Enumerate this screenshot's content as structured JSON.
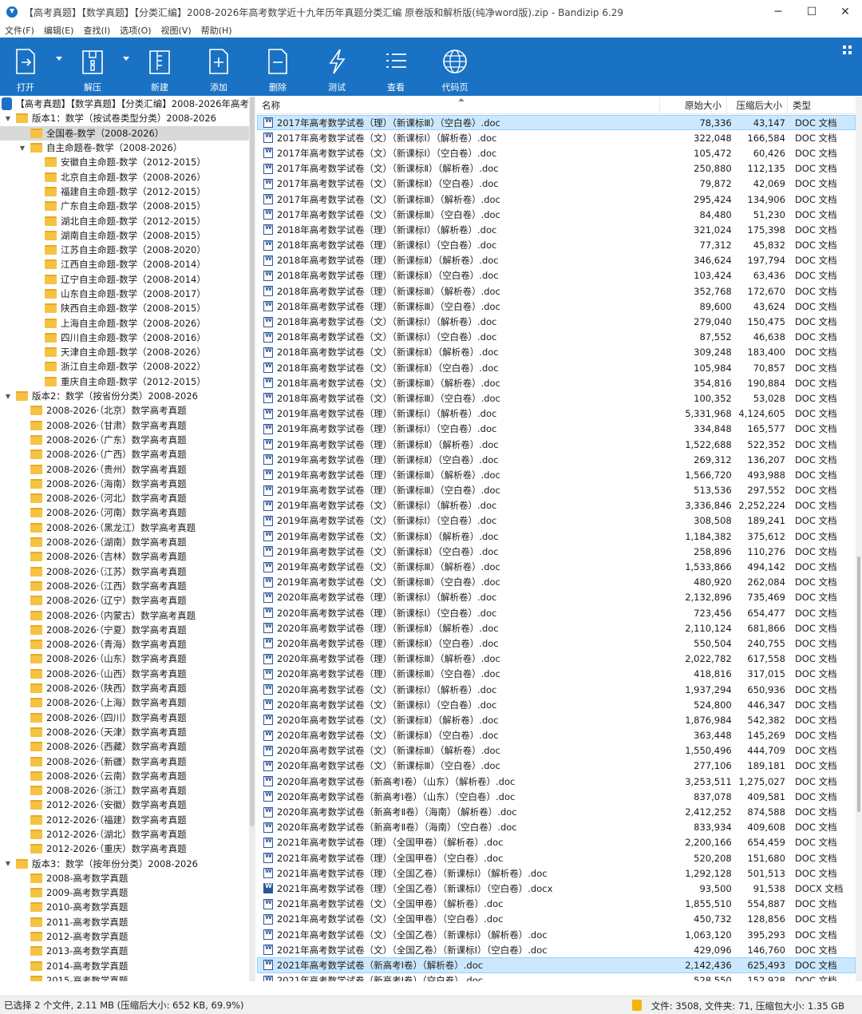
{
  "window": {
    "title": "【高考真题】【数学真题】【分类汇编】2008-2026年高考数学近十九年历年真题分类汇编  原卷版和解析版(纯净word版).zip - Bandizip 6.29",
    "minimize": "─",
    "maximize": "☐",
    "close": "✕"
  },
  "menu": [
    "文件(F)",
    "编辑(E)",
    "查找(I)",
    "选项(O)",
    "视图(V)",
    "帮助(H)"
  ],
  "toolbar": {
    "open": "打开",
    "extract": "解压",
    "new": "新建",
    "add": "添加",
    "delete": "删除",
    "test": "测试",
    "view": "查看",
    "codepage": "代码页"
  },
  "colors": {
    "toolbar": "#1a72c4",
    "selected_row": "#cce8ff",
    "folder": "#f5c242"
  },
  "tree": [
    {
      "text": "【高考真题】【数学真题】【分类汇编】2008-2026年高考",
      "level": 0,
      "type": "zip",
      "toggle": ""
    },
    {
      "text": "版本1：数学（按试卷类型分类）2008-2026",
      "level": 0,
      "type": "folder",
      "toggle": "▼"
    },
    {
      "text": "全国卷-数学（2008-2026）",
      "level": 1,
      "type": "folder",
      "toggle": "",
      "selected": true
    },
    {
      "text": "自主命题卷-数学（2008-2026）",
      "level": 1,
      "type": "folder",
      "toggle": "▼"
    },
    {
      "text": "安徽自主命题-数学（2012-2015）",
      "level": 2,
      "type": "folder",
      "toggle": ""
    },
    {
      "text": "北京自主命题-数学（2008-2026）",
      "level": 2,
      "type": "folder",
      "toggle": ""
    },
    {
      "text": "福建自主命题-数学（2012-2015）",
      "level": 2,
      "type": "folder",
      "toggle": ""
    },
    {
      "text": "广东自主命题-数学（2008-2015）",
      "level": 2,
      "type": "folder",
      "toggle": ""
    },
    {
      "text": "湖北自主命题-数学（2012-2015）",
      "level": 2,
      "type": "folder",
      "toggle": ""
    },
    {
      "text": "湖南自主命题-数学（2008-2015）",
      "level": 2,
      "type": "folder",
      "toggle": ""
    },
    {
      "text": "江苏自主命题-数学（2008-2020）",
      "level": 2,
      "type": "folder",
      "toggle": ""
    },
    {
      "text": "江西自主命题-数学（2008-2014）",
      "level": 2,
      "type": "folder",
      "toggle": ""
    },
    {
      "text": "辽宁自主命题-数学（2008-2014）",
      "level": 2,
      "type": "folder",
      "toggle": ""
    },
    {
      "text": "山东自主命题-数学（2008-2017）",
      "level": 2,
      "type": "folder",
      "toggle": ""
    },
    {
      "text": "陕西自主命题-数学（2008-2015）",
      "level": 2,
      "type": "folder",
      "toggle": ""
    },
    {
      "text": "上海自主命题-数学（2008-2026）",
      "level": 2,
      "type": "folder",
      "toggle": ""
    },
    {
      "text": "四川自主命题-数学（2008-2016）",
      "level": 2,
      "type": "folder",
      "toggle": ""
    },
    {
      "text": "天津自主命题-数学（2008-2026）",
      "level": 2,
      "type": "folder",
      "toggle": ""
    },
    {
      "text": "浙江自主命题-数学（2008-2022）",
      "level": 2,
      "type": "folder",
      "toggle": ""
    },
    {
      "text": "重庆自主命题-数学（2012-2015）",
      "level": 2,
      "type": "folder",
      "toggle": ""
    },
    {
      "text": "版本2：数学（按省份分类）2008-2026",
      "level": 0,
      "type": "folder",
      "toggle": "▼"
    },
    {
      "text": "2008-2026·（北京）数学高考真题",
      "level": 1,
      "type": "folder",
      "toggle": ""
    },
    {
      "text": "2008-2026·（甘肃）数学高考真题",
      "level": 1,
      "type": "folder",
      "toggle": ""
    },
    {
      "text": "2008-2026·（广东）数学高考真题",
      "level": 1,
      "type": "folder",
      "toggle": ""
    },
    {
      "text": "2008-2026·（广西）数学高考真题",
      "level": 1,
      "type": "folder",
      "toggle": ""
    },
    {
      "text": "2008-2026·（贵州）数学高考真题",
      "level": 1,
      "type": "folder",
      "toggle": ""
    },
    {
      "text": "2008-2026·（海南）数学高考真题",
      "level": 1,
      "type": "folder",
      "toggle": ""
    },
    {
      "text": "2008-2026·（河北）数学高考真题",
      "level": 1,
      "type": "folder",
      "toggle": ""
    },
    {
      "text": "2008-2026·（河南）数学高考真题",
      "level": 1,
      "type": "folder",
      "toggle": ""
    },
    {
      "text": "2008-2026·（黑龙江）数学高考真题",
      "level": 1,
      "type": "folder",
      "toggle": ""
    },
    {
      "text": "2008-2026·（湖南）数学高考真题",
      "level": 1,
      "type": "folder",
      "toggle": ""
    },
    {
      "text": "2008-2026·（吉林）数学高考真题",
      "level": 1,
      "type": "folder",
      "toggle": ""
    },
    {
      "text": "2008-2026·（江苏）数学高考真题",
      "level": 1,
      "type": "folder",
      "toggle": ""
    },
    {
      "text": "2008-2026·（江西）数学高考真题",
      "level": 1,
      "type": "folder",
      "toggle": ""
    },
    {
      "text": "2008-2026·（辽宁）数学高考真题",
      "level": 1,
      "type": "folder",
      "toggle": ""
    },
    {
      "text": "2008-2026·（内蒙古）数学高考真题",
      "level": 1,
      "type": "folder",
      "toggle": ""
    },
    {
      "text": "2008-2026·（宁夏）数学高考真题",
      "level": 1,
      "type": "folder",
      "toggle": ""
    },
    {
      "text": "2008-2026·（青海）数学高考真题",
      "level": 1,
      "type": "folder",
      "toggle": ""
    },
    {
      "text": "2008-2026·（山东）数学高考真题",
      "level": 1,
      "type": "folder",
      "toggle": ""
    },
    {
      "text": "2008-2026·（山西）数学高考真题",
      "level": 1,
      "type": "folder",
      "toggle": ""
    },
    {
      "text": "2008-2026·（陕西）数学高考真题",
      "level": 1,
      "type": "folder",
      "toggle": ""
    },
    {
      "text": "2008-2026·（上海）数学高考真题",
      "level": 1,
      "type": "folder",
      "toggle": ""
    },
    {
      "text": "2008-2026·（四川）数学高考真题",
      "level": 1,
      "type": "folder",
      "toggle": ""
    },
    {
      "text": "2008-2026·（天津）数学高考真题",
      "level": 1,
      "type": "folder",
      "toggle": ""
    },
    {
      "text": "2008-2026·（西藏）数学高考真题",
      "level": 1,
      "type": "folder",
      "toggle": ""
    },
    {
      "text": "2008-2026·（新疆）数学高考真题",
      "level": 1,
      "type": "folder",
      "toggle": ""
    },
    {
      "text": "2008-2026·（云南）数学高考真题",
      "level": 1,
      "type": "folder",
      "toggle": ""
    },
    {
      "text": "2008-2026·（浙江）数学高考真题",
      "level": 1,
      "type": "folder",
      "toggle": ""
    },
    {
      "text": "2012-2026·（安徽）数学高考真题",
      "level": 1,
      "type": "folder",
      "toggle": ""
    },
    {
      "text": "2012-2026·（福建）数学高考真题",
      "level": 1,
      "type": "folder",
      "toggle": ""
    },
    {
      "text": "2012-2026·（湖北）数学高考真题",
      "level": 1,
      "type": "folder",
      "toggle": ""
    },
    {
      "text": "2012-2026·（重庆）数学高考真题",
      "level": 1,
      "type": "folder",
      "toggle": ""
    },
    {
      "text": "版本3：数学（按年份分类）2008-2026",
      "level": 0,
      "type": "folder",
      "toggle": "▼"
    },
    {
      "text": "2008-高考数学真题",
      "level": 1,
      "type": "folder",
      "toggle": ""
    },
    {
      "text": "2009-高考数学真题",
      "level": 1,
      "type": "folder",
      "toggle": ""
    },
    {
      "text": "2010-高考数学真题",
      "level": 1,
      "type": "folder",
      "toggle": ""
    },
    {
      "text": "2011-高考数学真题",
      "level": 1,
      "type": "folder",
      "toggle": ""
    },
    {
      "text": "2012-高考数学真题",
      "level": 1,
      "type": "folder",
      "toggle": ""
    },
    {
      "text": "2013-高考数学真题",
      "level": 1,
      "type": "folder",
      "toggle": ""
    },
    {
      "text": "2014-高考数学真题",
      "level": 1,
      "type": "folder",
      "toggle": ""
    },
    {
      "text": "2015-高考数学真题",
      "level": 1,
      "type": "folder",
      "toggle": ""
    }
  ],
  "list_header": {
    "name": "名称",
    "size": "原始大小",
    "packed": "压缩后大小",
    "type": "类型"
  },
  "files": [
    {
      "name": "2017年高考数学试卷（理）（新课标Ⅲ）（空白卷）.doc",
      "size": "78,336",
      "packed": "43,147",
      "type": "DOC 文档",
      "selected": true
    },
    {
      "name": "2017年高考数学试卷（文）（新课标Ⅰ）（解析卷）.doc",
      "size": "322,048",
      "packed": "166,584",
      "type": "DOC 文档"
    },
    {
      "name": "2017年高考数学试卷（文）（新课标Ⅰ）（空白卷）.doc",
      "size": "105,472",
      "packed": "60,426",
      "type": "DOC 文档"
    },
    {
      "name": "2017年高考数学试卷（文）（新课标Ⅱ）（解析卷）.doc",
      "size": "250,880",
      "packed": "112,135",
      "type": "DOC 文档"
    },
    {
      "name": "2017年高考数学试卷（文）（新课标Ⅱ）（空白卷）.doc",
      "size": "79,872",
      "packed": "42,069",
      "type": "DOC 文档"
    },
    {
      "name": "2017年高考数学试卷（文）（新课标Ⅲ）（解析卷）.doc",
      "size": "295,424",
      "packed": "134,906",
      "type": "DOC 文档"
    },
    {
      "name": "2017年高考数学试卷（文）（新课标Ⅲ）（空白卷）.doc",
      "size": "84,480",
      "packed": "51,230",
      "type": "DOC 文档"
    },
    {
      "name": "2018年高考数学试卷（理）（新课标Ⅰ）（解析卷）.doc",
      "size": "321,024",
      "packed": "175,398",
      "type": "DOC 文档"
    },
    {
      "name": "2018年高考数学试卷（理）（新课标Ⅰ）（空白卷）.doc",
      "size": "77,312",
      "packed": "45,832",
      "type": "DOC 文档"
    },
    {
      "name": "2018年高考数学试卷（理）（新课标Ⅱ）（解析卷）.doc",
      "size": "346,624",
      "packed": "197,794",
      "type": "DOC 文档"
    },
    {
      "name": "2018年高考数学试卷（理）（新课标Ⅱ）（空白卷）.doc",
      "size": "103,424",
      "packed": "63,436",
      "type": "DOC 文档"
    },
    {
      "name": "2018年高考数学试卷（理）（新课标Ⅲ）（解析卷）.doc",
      "size": "352,768",
      "packed": "172,670",
      "type": "DOC 文档"
    },
    {
      "name": "2018年高考数学试卷（理）（新课标Ⅲ）（空白卷）.doc",
      "size": "89,600",
      "packed": "43,624",
      "type": "DOC 文档"
    },
    {
      "name": "2018年高考数学试卷（文）（新课标Ⅰ）（解析卷）.doc",
      "size": "279,040",
      "packed": "150,475",
      "type": "DOC 文档"
    },
    {
      "name": "2018年高考数学试卷（文）（新课标Ⅰ）（空白卷）.doc",
      "size": "87,552",
      "packed": "46,638",
      "type": "DOC 文档"
    },
    {
      "name": "2018年高考数学试卷（文）（新课标Ⅱ）（解析卷）.doc",
      "size": "309,248",
      "packed": "183,400",
      "type": "DOC 文档"
    },
    {
      "name": "2018年高考数学试卷（文）（新课标Ⅱ）（空白卷）.doc",
      "size": "105,984",
      "packed": "70,857",
      "type": "DOC 文档"
    },
    {
      "name": "2018年高考数学试卷（文）（新课标Ⅲ）（解析卷）.doc",
      "size": "354,816",
      "packed": "190,884",
      "type": "DOC 文档"
    },
    {
      "name": "2018年高考数学试卷（文）（新课标Ⅲ）（空白卷）.doc",
      "size": "100,352",
      "packed": "53,028",
      "type": "DOC 文档"
    },
    {
      "name": "2019年高考数学试卷（理）（新课标Ⅰ）（解析卷）.doc",
      "size": "5,331,968",
      "packed": "4,124,605",
      "type": "DOC 文档"
    },
    {
      "name": "2019年高考数学试卷（理）（新课标Ⅰ）（空白卷）.doc",
      "size": "334,848",
      "packed": "165,577",
      "type": "DOC 文档"
    },
    {
      "name": "2019年高考数学试卷（理）（新课标Ⅱ）（解析卷）.doc",
      "size": "1,522,688",
      "packed": "522,352",
      "type": "DOC 文档"
    },
    {
      "name": "2019年高考数学试卷（理）（新课标Ⅱ）（空白卷）.doc",
      "size": "269,312",
      "packed": "136,207",
      "type": "DOC 文档"
    },
    {
      "name": "2019年高考数学试卷（理）（新课标Ⅲ）（解析卷）.doc",
      "size": "1,566,720",
      "packed": "493,988",
      "type": "DOC 文档"
    },
    {
      "name": "2019年高考数学试卷（理）（新课标Ⅲ）（空白卷）.doc",
      "size": "513,536",
      "packed": "297,552",
      "type": "DOC 文档"
    },
    {
      "name": "2019年高考数学试卷（文）（新课标Ⅰ）（解析卷）.doc",
      "size": "3,336,846",
      "packed": "2,252,224",
      "type": "DOC 文档"
    },
    {
      "name": "2019年高考数学试卷（文）（新课标Ⅰ）（空白卷）.doc",
      "size": "308,508",
      "packed": "189,241",
      "type": "DOC 文档"
    },
    {
      "name": "2019年高考数学试卷（文）（新课标Ⅱ）（解析卷）.doc",
      "size": "1,184,382",
      "packed": "375,612",
      "type": "DOC 文档"
    },
    {
      "name": "2019年高考数学试卷（文）（新课标Ⅱ）（空白卷）.doc",
      "size": "258,896",
      "packed": "110,276",
      "type": "DOC 文档"
    },
    {
      "name": "2019年高考数学试卷（文）（新课标Ⅲ）（解析卷）.doc",
      "size": "1,533,866",
      "packed": "494,142",
      "type": "DOC 文档"
    },
    {
      "name": "2019年高考数学试卷（文）（新课标Ⅲ）（空白卷）.doc",
      "size": "480,920",
      "packed": "262,084",
      "type": "DOC 文档"
    },
    {
      "name": "2020年高考数学试卷（理）（新课标Ⅰ）（解析卷）.doc",
      "size": "2,132,896",
      "packed": "735,469",
      "type": "DOC 文档"
    },
    {
      "name": "2020年高考数学试卷（理）（新课标Ⅰ）（空白卷）.doc",
      "size": "723,456",
      "packed": "654,477",
      "type": "DOC 文档"
    },
    {
      "name": "2020年高考数学试卷（理）（新课标Ⅱ）（解析卷）.doc",
      "size": "2,110,124",
      "packed": "681,866",
      "type": "DOC 文档"
    },
    {
      "name": "2020年高考数学试卷（理）（新课标Ⅱ）（空白卷）.doc",
      "size": "550,504",
      "packed": "240,755",
      "type": "DOC 文档"
    },
    {
      "name": "2020年高考数学试卷（理）（新课标Ⅲ）（解析卷）.doc",
      "size": "2,022,782",
      "packed": "617,558",
      "type": "DOC 文档"
    },
    {
      "name": "2020年高考数学试卷（理）（新课标Ⅲ）（空白卷）.doc",
      "size": "418,816",
      "packed": "317,015",
      "type": "DOC 文档"
    },
    {
      "name": "2020年高考数学试卷（文）（新课标Ⅰ）（解析卷）.doc",
      "size": "1,937,294",
      "packed": "650,936",
      "type": "DOC 文档"
    },
    {
      "name": "2020年高考数学试卷（文）（新课标Ⅰ）（空白卷）.doc",
      "size": "524,800",
      "packed": "446,347",
      "type": "DOC 文档"
    },
    {
      "name": "2020年高考数学试卷（文）（新课标Ⅱ）（解析卷）.doc",
      "size": "1,876,984",
      "packed": "542,382",
      "type": "DOC 文档"
    },
    {
      "name": "2020年高考数学试卷（文）（新课标Ⅱ）（空白卷）.doc",
      "size": "363,448",
      "packed": "145,269",
      "type": "DOC 文档"
    },
    {
      "name": "2020年高考数学试卷（文）（新课标Ⅲ）（解析卷）.doc",
      "size": "1,550,496",
      "packed": "444,709",
      "type": "DOC 文档"
    },
    {
      "name": "2020年高考数学试卷（文）（新课标Ⅲ）（空白卷）.doc",
      "size": "277,106",
      "packed": "189,181",
      "type": "DOC 文档"
    },
    {
      "name": "2020年高考数学试卷（新高考Ⅰ卷）（山东）（解析卷）.doc",
      "size": "3,253,511",
      "packed": "1,275,027",
      "type": "DOC 文档"
    },
    {
      "name": "2020年高考数学试卷（新高考Ⅰ卷）（山东）（空白卷）.doc",
      "size": "837,078",
      "packed": "409,581",
      "type": "DOC 文档"
    },
    {
      "name": "2020年高考数学试卷（新高考Ⅱ卷）（海南）（解析卷）.doc",
      "size": "2,412,252",
      "packed": "874,588",
      "type": "DOC 文档"
    },
    {
      "name": "2020年高考数学试卷（新高考Ⅱ卷）（海南）（空白卷）.doc",
      "size": "833,934",
      "packed": "409,608",
      "type": "DOC 文档"
    },
    {
      "name": "2021年高考数学试卷（理）（全国甲卷）（解析卷）.doc",
      "size": "2,200,166",
      "packed": "654,459",
      "type": "DOC 文档"
    },
    {
      "name": "2021年高考数学试卷（理）（全国甲卷）（空白卷）.doc",
      "size": "520,208",
      "packed": "151,680",
      "type": "DOC 文档"
    },
    {
      "name": "2021年高考数学试卷（理）（全国乙卷）（新课标Ⅰ）（解析卷）.doc",
      "size": "1,292,128",
      "packed": "501,513",
      "type": "DOC 文档"
    },
    {
      "name": "2021年高考数学试卷（理）（全国乙卷）（新课标Ⅰ）（空白卷）.docx",
      "size": "93,500",
      "packed": "91,538",
      "type": "DOCX 文档",
      "docx": true
    },
    {
      "name": "2021年高考数学试卷（文）（全国甲卷）（解析卷）.doc",
      "size": "1,855,510",
      "packed": "554,887",
      "type": "DOC 文档"
    },
    {
      "name": "2021年高考数学试卷（文）（全国甲卷）（空白卷）.doc",
      "size": "450,732",
      "packed": "128,856",
      "type": "DOC 文档"
    },
    {
      "name": "2021年高考数学试卷（文）（全国乙卷）（新课标Ⅰ）（解析卷）.doc",
      "size": "1,063,120",
      "packed": "395,293",
      "type": "DOC 文档"
    },
    {
      "name": "2021年高考数学试卷（文）（全国乙卷）（新课标Ⅰ）（空白卷）.doc",
      "size": "429,096",
      "packed": "146,760",
      "type": "DOC 文档"
    },
    {
      "name": "2021年高考数学试卷（新高考Ⅰ卷）（解析卷）.doc",
      "size": "2,142,436",
      "packed": "625,493",
      "type": "DOC 文档",
      "selected": true
    },
    {
      "name": "2021年高考数学试卷（新高考Ⅰ卷）（空白卷）.doc",
      "size": "528,550",
      "packed": "152,928",
      "type": "DOC 文档"
    }
  ],
  "status": {
    "left": "已选择 2 个文件, 2.11 MB (压缩后大小: 652 KB, 69.9%)",
    "right": "文件: 3508, 文件夹: 71, 压缩包大小: 1.35 GB"
  }
}
